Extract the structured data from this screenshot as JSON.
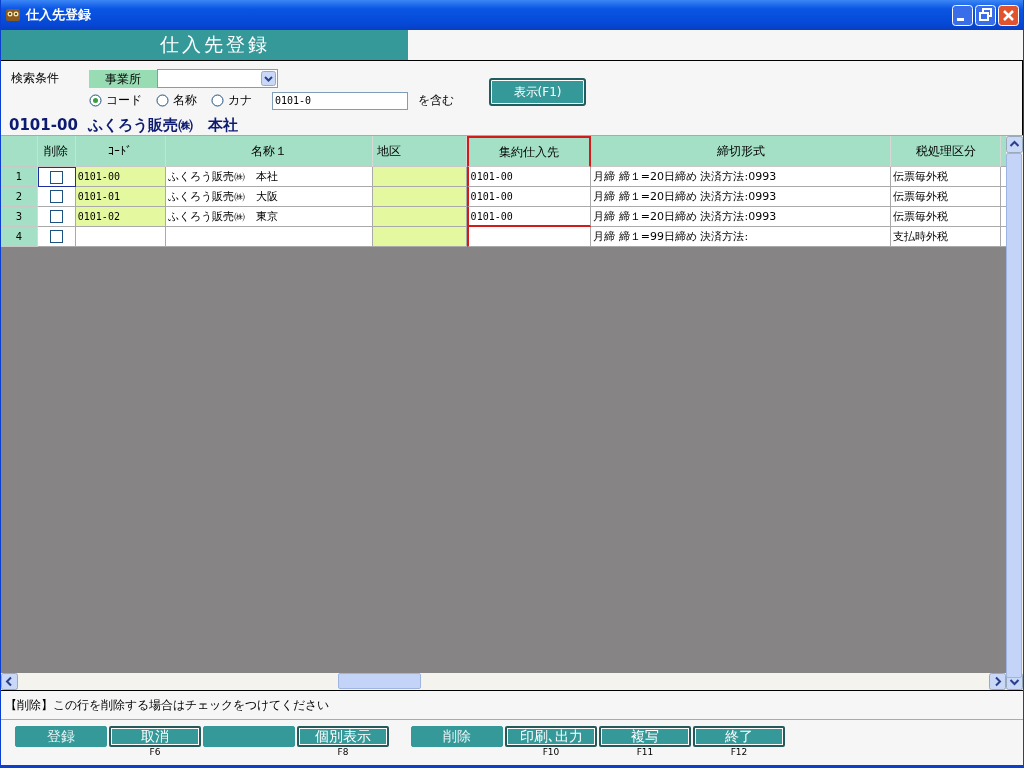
{
  "window": {
    "title": "仕入先登録"
  },
  "header": {
    "title": "仕入先登録"
  },
  "search": {
    "label": "検索条件",
    "office": {
      "label": "事業所"
    },
    "radios": [
      {
        "label": "コード",
        "selected": true
      },
      {
        "label": "名称",
        "selected": false
      },
      {
        "label": "カナ",
        "selected": false
      }
    ],
    "query": {
      "value": "0101-0"
    },
    "suffix": "を含む",
    "button": "表示(F1)"
  },
  "caption": "0101-00  ふくろう販売㈱　本社",
  "grid": {
    "columns": [
      {
        "label": "削除",
        "highlighted": false,
        "shaded": false
      },
      {
        "label": "ｺｰﾄﾞ",
        "highlighted": false,
        "shaded": true
      },
      {
        "label": "名称１",
        "highlighted": false,
        "shaded": false
      },
      {
        "label": "地区",
        "highlighted": false,
        "shaded": true
      },
      {
        "label": "集約仕入先",
        "highlighted": true,
        "shaded": false
      },
      {
        "label": "締切形式",
        "highlighted": false,
        "shaded": false
      },
      {
        "label": "税処理区分",
        "highlighted": false,
        "shaded": false
      }
    ],
    "rows": [
      {
        "number": "1",
        "checked": false,
        "focused": true,
        "code": "0101-00",
        "name": "ふくろう販売㈱　本社",
        "group_supplier": "0101-00",
        "closing": "月締 締１=20日締め 決済方法:0993",
        "tax": "伝票毎外税"
      },
      {
        "number": "2",
        "checked": false,
        "focused": false,
        "code": "0101-01",
        "name": "ふくろう販売㈱　大阪",
        "group_supplier": "0101-00",
        "closing": "月締 締１=20日締め 決済方法:0993",
        "tax": "伝票毎外税"
      },
      {
        "number": "3",
        "checked": false,
        "focused": false,
        "code": "0101-02",
        "name": "ふくろう販売㈱　東京",
        "group_supplier": "0101-00",
        "closing": "月締 締１=20日締め 決済方法:0993",
        "tax": "伝票毎外税"
      },
      {
        "number": "4",
        "checked": false,
        "focused": false,
        "closing": "月締 締１=99日締め 決済方法:",
        "tax": "支払時外税"
      }
    ]
  },
  "message": "【削除】この行を削除する場合はチェックをつけてください",
  "function_key_groups": [
    [
      {
        "label": "登録",
        "enabled": false
      },
      {
        "label": "取消",
        "key": "F6",
        "enabled": true
      },
      {
        "enabled": false
      },
      {
        "label": "個別表示",
        "key": "F8",
        "enabled": true
      }
    ],
    [
      {
        "label": "削除",
        "enabled": false
      },
      {
        "label": "印刷､出力",
        "key": "F10",
        "enabled": true
      },
      {
        "label": "複写",
        "key": "F11",
        "enabled": true
      },
      {
        "label": "終了",
        "key": "F12",
        "enabled": true
      }
    ]
  ]
}
